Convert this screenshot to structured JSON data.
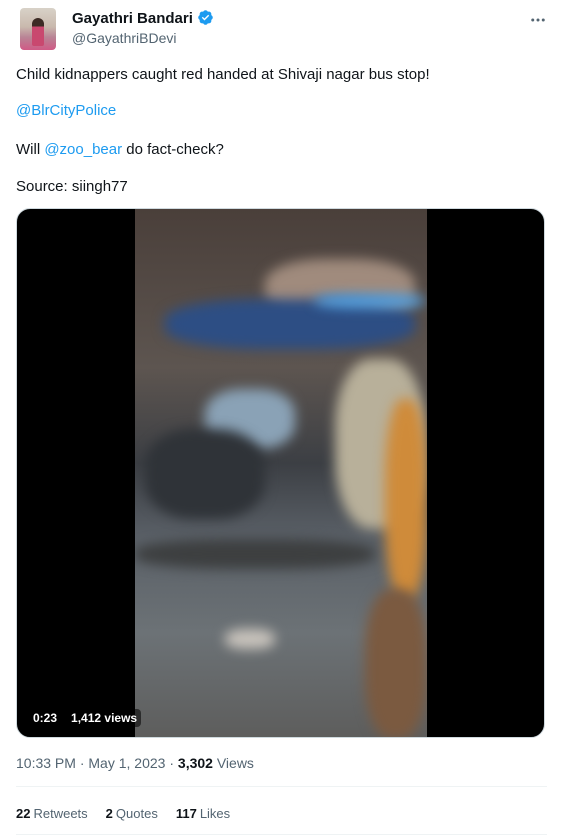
{
  "user": {
    "name": "Gayathri Bandari",
    "handle": "@GayathriBDevi"
  },
  "tweet": {
    "line1": "Child kidnappers caught red handed at Shivaji nagar bus stop!",
    "mention1": "@BlrCityPolice",
    "line3_pre": "Will ",
    "mention2": "@zoo_bear",
    "line3_post": " do fact-check?",
    "source": "Source: siingh77"
  },
  "video": {
    "duration": "0:23",
    "views": "1,412 views"
  },
  "meta": {
    "time": "10:33 PM",
    "sep1": " · ",
    "date": "May 1, 2023",
    "sep2": " · ",
    "views_count": "3,302",
    "views_label": " Views"
  },
  "stats": {
    "retweets_count": "22",
    "retweets_label": "Retweets",
    "quotes_count": "2",
    "quotes_label": "Quotes",
    "likes_count": "117",
    "likes_label": "Likes"
  },
  "colors": {
    "link": "#1d9bf0",
    "verified": "#1d9bf0",
    "muted": "#536471"
  }
}
